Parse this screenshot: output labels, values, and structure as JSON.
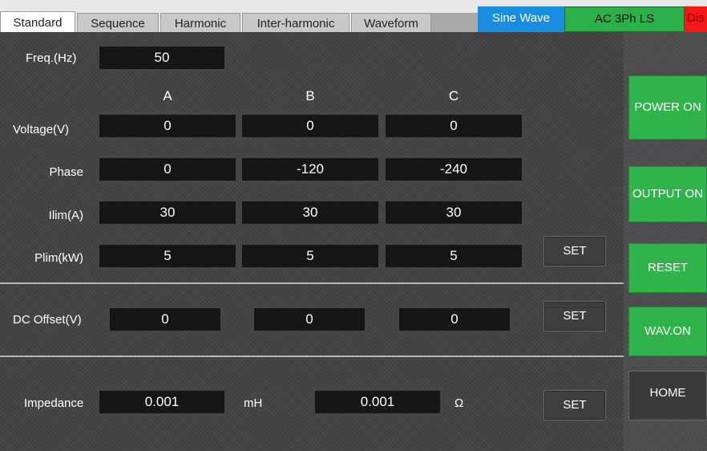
{
  "tabs": [
    {
      "label": "Standard",
      "active": true
    },
    {
      "label": "Sequence",
      "active": false
    },
    {
      "label": "Harmonic",
      "active": false
    },
    {
      "label": "Inter-harmonic",
      "active": false
    },
    {
      "label": "Waveform",
      "active": false
    }
  ],
  "status": {
    "waveform": "Sine Wave",
    "mode": "AC  3Ph  LS",
    "alarm": "Dis"
  },
  "freq": {
    "label": "Freq.(Hz)",
    "value": "50"
  },
  "phases": {
    "a": "A",
    "b": "B",
    "c": "C"
  },
  "rows": {
    "voltage": {
      "label": "Voltage(V)",
      "a": "0",
      "b": "0",
      "c": "0"
    },
    "phase": {
      "label": "Phase",
      "a": "0",
      "b": "-120",
      "c": "-240"
    },
    "ilim": {
      "label": "Ilim(A)",
      "a": "30",
      "b": "30",
      "c": "30"
    },
    "plim": {
      "label": "Plim(kW)",
      "a": "5",
      "b": "5",
      "c": "5"
    }
  },
  "set_label": "SET",
  "dc_offset": {
    "label": "DC Offset(V)",
    "a": "0",
    "b": "0",
    "c": "0"
  },
  "impedance": {
    "label": "Impedance",
    "inductance": "0.001",
    "inductance_unit": "mH",
    "resistance": "0.001",
    "resistance_unit": "Ω"
  },
  "side": {
    "power_on": "POWER ON",
    "output_on": "OUTPUT ON",
    "reset": "RESET",
    "wav_on": "WAV.ON",
    "home": "HOME"
  },
  "colors": {
    "green": "#2fb34a",
    "blue": "#1a8de0",
    "red": "#f01818",
    "field": "#161616"
  }
}
